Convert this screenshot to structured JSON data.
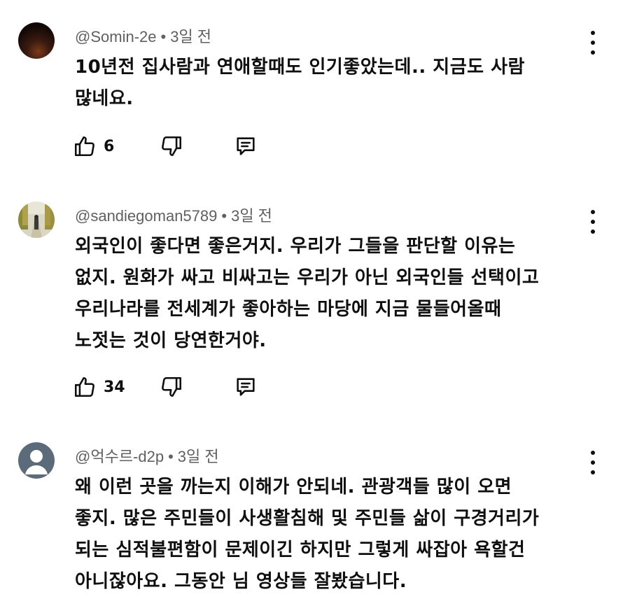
{
  "comments": [
    {
      "handle": "@Somin-2e",
      "separator": "•",
      "time": "3일 전",
      "text": "10년전 집사람과 연애할때도 인기좋았는데.. 지금도 사람\n많네요.",
      "likes": "6",
      "avatar": "dark-photo"
    },
    {
      "handle": "@sandiegoman5789",
      "separator": "•",
      "time": "3일 전",
      "text": "외국인이 좋다면 좋은거지. 우리가 그들을 판단할 이유는\n없지. 원화가 싸고 비싸고는 우리가 아닌 외국인들 선택이고\n우리나라를 전세계가 좋아하는 마당에 지금 물들어올때\n노젓는 것이 당연한거야.",
      "likes": "34",
      "avatar": "tree-lined-path-photo"
    },
    {
      "handle": "@억수르-d2p",
      "separator": "•",
      "time": "3일 전",
      "text": "왜 이런 곳을 까는지 이해가 안되네. 관광객들 많이 오면\n좋지. 많은 주민들이 사생활침해 및 주민들 삶이 구경거리가\n되는 심적불편함이 문제이긴 하지만 그렇게 싸잡아 욕할건\n아니잖아요. 그동안 님 영상들  잘봤습니다.",
      "likes": "",
      "avatar": "default-person-avatar"
    }
  ],
  "icons": {
    "like": "thumb-up-icon",
    "dislike": "thumb-down-icon",
    "reply": "reply-icon",
    "more": "more-vert-icon"
  },
  "colors": {
    "meta_text": "#606060",
    "body_text": "#0f0f0f",
    "default_avatar_bg": "#5b6b7a"
  }
}
